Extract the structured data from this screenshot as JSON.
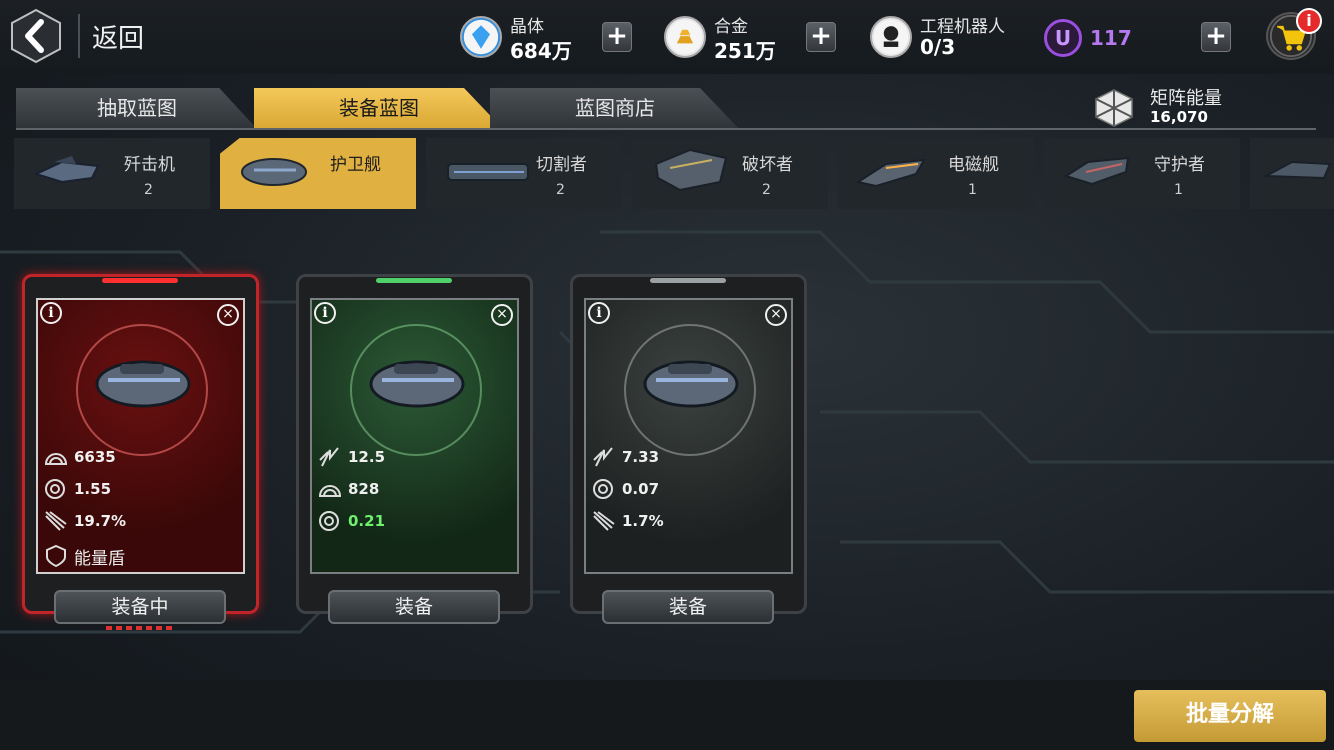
{
  "topbar": {
    "back_label": "返回",
    "resources": [
      {
        "name": "晶体",
        "value": "684万",
        "icon": "crystal-icon"
      },
      {
        "name": "合金",
        "value": "251万",
        "icon": "alloy-icon"
      },
      {
        "name": "工程机器人",
        "value": "0/3",
        "icon": "robot-icon"
      }
    ],
    "u_currency": {
      "letter": "U",
      "value": "117"
    },
    "plus_label": "+",
    "cart_badge": "i"
  },
  "tabs": [
    {
      "label": "抽取蓝图",
      "active": false
    },
    {
      "label": "装备蓝图",
      "active": true
    },
    {
      "label": "蓝图商店",
      "active": false
    }
  ],
  "matrix": {
    "name": "矩阵能量",
    "value": "16,070"
  },
  "categories": [
    {
      "name": "歼击机",
      "count": "2",
      "active": false
    },
    {
      "name": "护卫舰",
      "count": "",
      "active": true
    },
    {
      "name": "切割者",
      "count": "2",
      "active": false
    },
    {
      "name": "破坏者",
      "count": "2",
      "active": false
    },
    {
      "name": "电磁舰",
      "count": "1",
      "active": false
    },
    {
      "name": "守护者",
      "count": "1",
      "active": false
    }
  ],
  "cards": [
    {
      "rarity": "red",
      "stats": [
        {
          "icon": "armor-icon",
          "value": "6635"
        },
        {
          "icon": "shield-gear-icon",
          "value": "1.55"
        },
        {
          "icon": "missile-icon",
          "value": "19.7%"
        }
      ],
      "extra": {
        "icon": "energy-shield-icon",
        "value": "能量盾"
      },
      "button": "装备中"
    },
    {
      "rarity": "green",
      "stats": [
        {
          "icon": "lightning-icon",
          "value": "12.5"
        },
        {
          "icon": "armor-icon",
          "value": "828"
        },
        {
          "icon": "shield-gear-icon",
          "value": "0.21",
          "highlight": true
        }
      ],
      "button": "装备"
    },
    {
      "rarity": "gray",
      "stats": [
        {
          "icon": "lightning-icon",
          "value": "7.33"
        },
        {
          "icon": "shield-gear-icon",
          "value": "0.07"
        },
        {
          "icon": "missile-icon",
          "value": "1.7%"
        }
      ],
      "button": "装备"
    }
  ],
  "batch_button": "批量分解",
  "colors": {
    "gold": "#e0b041",
    "red": "#c1252a",
    "green": "#4fd06a",
    "purple": "#9a4fe0"
  }
}
